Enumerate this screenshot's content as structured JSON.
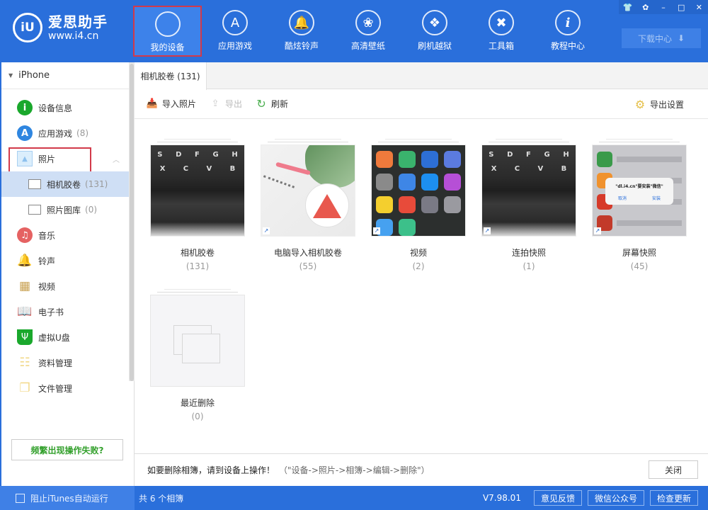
{
  "header": {
    "logo_mark": "iU",
    "logo_title": "爱思助手",
    "logo_url": "www.i4.cn",
    "nav": [
      {
        "label": "我的设备",
        "icon": "apple-icon",
        "glyph": "",
        "active": true
      },
      {
        "label": "应用游戏",
        "icon": "app-store-icon",
        "glyph": "A"
      },
      {
        "label": "酷炫铃声",
        "icon": "bell-icon",
        "glyph": "🔔"
      },
      {
        "label": "高清壁纸",
        "icon": "flower-icon",
        "glyph": "❀"
      },
      {
        "label": "刷机越狱",
        "icon": "dropbox-icon",
        "glyph": "❖"
      },
      {
        "label": "工具箱",
        "icon": "tools-icon",
        "glyph": "✖"
      },
      {
        "label": "教程中心",
        "icon": "info-icon",
        "glyph": "i"
      }
    ],
    "window_controls": {
      "skin": "👕",
      "settings": "✿",
      "minimize": "–",
      "maximize": "□",
      "close": "✕"
    },
    "download_center": "下载中心",
    "download_icon": "⬇"
  },
  "sidebar": {
    "device": "iPhone",
    "items": [
      {
        "label": "设备信息",
        "icon": "info-icon",
        "glyph": "i",
        "color": "#1aa82c"
      },
      {
        "label": "应用游戏",
        "count": "(8)",
        "icon": "app-store-icon",
        "glyph": "A",
        "color": "#2f86e0"
      },
      {
        "label": "照片",
        "icon": "photo-icon",
        "glyph": "▲",
        "color": "#8ec1ee"
      },
      {
        "label": "相机胶卷",
        "count": "(131)",
        "icon": "album-icon"
      },
      {
        "label": "照片图库",
        "count": "(0)",
        "icon": "folder-icon"
      },
      {
        "label": "音乐",
        "icon": "music-icon",
        "glyph": "♫",
        "color": "#e56262"
      },
      {
        "label": "铃声",
        "icon": "bell-icon",
        "glyph": "🔔",
        "color": "#4aa3f0"
      },
      {
        "label": "视频",
        "icon": "film-icon",
        "glyph": "▦",
        "color": "#c8a050"
      },
      {
        "label": "电子书",
        "icon": "book-icon",
        "glyph": "📖",
        "color": "#f2cd7b"
      },
      {
        "label": "虚拟U盘",
        "icon": "usb-icon",
        "glyph": "Ψ",
        "color": "#1aa82c"
      },
      {
        "label": "资料管理",
        "icon": "contacts-icon",
        "glyph": "☷",
        "color": "#f2d98a"
      },
      {
        "label": "文件管理",
        "icon": "files-icon",
        "glyph": "❐",
        "color": "#f2d98a"
      }
    ],
    "help_button": "频繁出现操作失败?"
  },
  "main": {
    "tab": "相机胶卷 (131)",
    "toolbar": {
      "import": "导入照片",
      "export": "导出",
      "refresh": "刷新",
      "export_settings": "导出设置"
    },
    "albums": [
      {
        "name": "相机胶卷",
        "count": "(131)",
        "thumb": "keyboard",
        "shortcut": false
      },
      {
        "name": "电脑导入相机胶卷",
        "count": "(55)",
        "thumb": "desk",
        "shortcut": true
      },
      {
        "name": "视频",
        "count": "(2)",
        "thumb": "phone",
        "shortcut": true
      },
      {
        "name": "连拍快照",
        "count": "(1)",
        "thumb": "keyboard",
        "shortcut": true
      },
      {
        "name": "屏幕快照",
        "count": "(45)",
        "thumb": "screen",
        "shortcut": true
      },
      {
        "name": "最近删除",
        "count": "(0)",
        "thumb": "empty",
        "shortcut": false
      }
    ],
    "keyboard_keys_row1": [
      "S",
      "D",
      "F",
      "G",
      "H"
    ],
    "keyboard_keys_row2": [
      "X",
      "C",
      "V",
      "B"
    ],
    "screen_dialog": {
      "title": "\"dl.i4.cn\"要安装\"微信\"",
      "cancel": "取消",
      "install": "安装"
    },
    "notice": "如要删除相簿，请到设备上操作！",
    "notice_hint": "（\"设备->照片->相簿->编辑->删除\"）",
    "close_button": "关闭"
  },
  "statusbar": {
    "itunes_checkbox": "阻止iTunes自动运行",
    "album_count": "共 6 个相簿",
    "version": "V7.98.01",
    "feedback": "意见反馈",
    "wechat": "微信公众号",
    "check_update": "检查更新"
  }
}
